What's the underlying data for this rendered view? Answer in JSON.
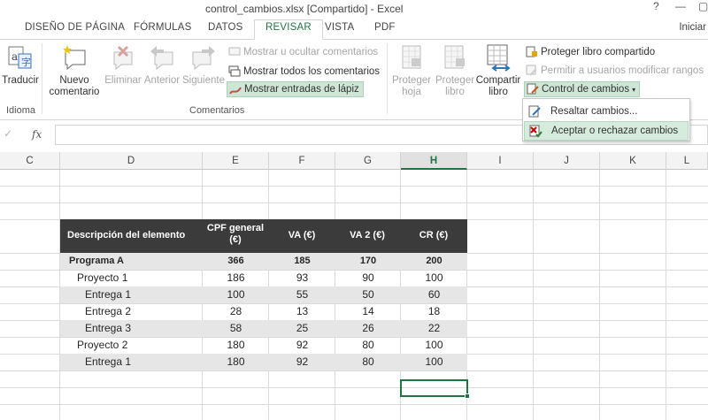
{
  "window": {
    "title": "control_cambios.xlsx  [Compartido] - Excel",
    "help": "?",
    "restore": "▢",
    "signin": "Iniciar"
  },
  "tabs": [
    {
      "label": "DISEÑO DE PÁGINA"
    },
    {
      "label": "FÓRMULAS"
    },
    {
      "label": "DATOS"
    },
    {
      "label": "REVISAR"
    },
    {
      "label": "VISTA"
    },
    {
      "label": "PDF"
    }
  ],
  "ribbon": {
    "idioma": {
      "traducir": "Traducir",
      "group": "Idioma"
    },
    "comentarios": {
      "nuevo_1": "Nuevo",
      "nuevo_2": "comentario",
      "eliminar": "Eliminar",
      "anterior": "Anterior",
      "siguiente": "Siguiente",
      "mostrar_ocultar": "Mostrar u ocultar comentarios",
      "mostrar_todos": "Mostrar todos los comentarios",
      "mostrar_lapiz": "Mostrar entradas de lápiz",
      "group": "Comentarios"
    },
    "cambios": {
      "proteger_hoja_1": "Proteger",
      "proteger_hoja_2": "hoja",
      "proteger_libro_1": "Proteger",
      "proteger_libro_2": "libro",
      "compartir_1": "Compartir",
      "compartir_2": "libro",
      "proteger_compartido": "Proteger libro compartido",
      "permitir": "Permitir a usuarios modificar rangos",
      "control": "Control de cambios"
    }
  },
  "menu": {
    "resaltar": "Resaltar cambios...",
    "aceptar": "Aceptar o rechazar cambios"
  },
  "formula_bar": {
    "cancel": "✓",
    "fx": "fx",
    "value": ""
  },
  "columns": [
    "C",
    "D",
    "E",
    "F",
    "G",
    "H",
    "I",
    "J",
    "K",
    "L"
  ],
  "selected_column": "H",
  "table": {
    "headers": [
      "Descripción del elemento",
      "CPF general (€)",
      "VA (€)",
      "VA 2 (€)",
      "CR (€)"
    ],
    "rows": [
      {
        "name": "Programa A",
        "bold": true,
        "indent": 0,
        "values": [
          "366",
          "185",
          "170",
          "200"
        ]
      },
      {
        "name": "Proyecto 1",
        "bold": false,
        "indent": 1,
        "values": [
          "186",
          "93",
          "90",
          "100"
        ]
      },
      {
        "name": "Entrega 1",
        "bold": false,
        "indent": 2,
        "values": [
          "100",
          "55",
          "50",
          "60"
        ]
      },
      {
        "name": "Entrega 2",
        "bold": false,
        "indent": 2,
        "values": [
          "28",
          "13",
          "14",
          "18"
        ]
      },
      {
        "name": "Entrega 3",
        "bold": false,
        "indent": 2,
        "values": [
          "58",
          "25",
          "26",
          "22"
        ]
      },
      {
        "name": "Proyecto 2",
        "bold": false,
        "indent": 1,
        "values": [
          "180",
          "92",
          "80",
          "100"
        ]
      },
      {
        "name": "Entrega 1",
        "bold": false,
        "indent": 2,
        "values": [
          "180",
          "92",
          "80",
          "100"
        ]
      }
    ]
  },
  "colors": {
    "accent": "#217346",
    "header_fill": "#3b3b3b",
    "band_fill": "#e6e6e6"
  }
}
